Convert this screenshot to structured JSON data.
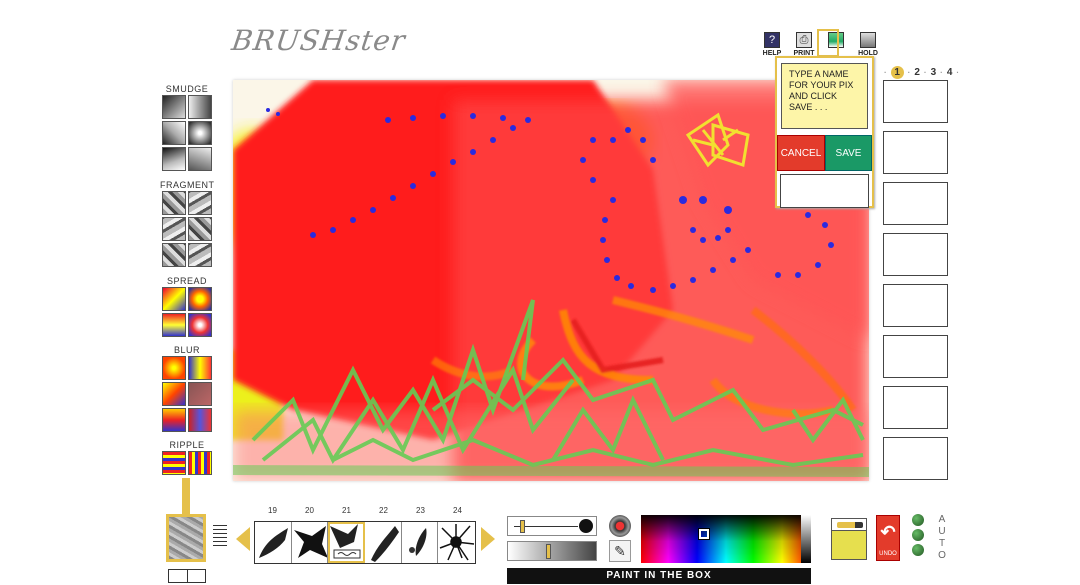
{
  "app": {
    "title": "BRUSHster"
  },
  "toolbar": {
    "help_label": "HELP",
    "print_label": "PRINT",
    "hold_label": "HOLD",
    "help_glyph": "?",
    "print_glyph": "⎙"
  },
  "tools": {
    "smudge_label": "SMUDGE",
    "fragment_label": "FRAGMENT",
    "spread_label": "SPREAD",
    "blur_label": "BLUR",
    "ripple_label": "RIPPLE"
  },
  "save_dialog": {
    "prompt": "TYPE A NAME FOR YOUR PIX AND CLICK SAVE . . .",
    "cancel_label": "CANCEL",
    "save_label": "SAVE",
    "name_value": ""
  },
  "gallery": {
    "pages": [
      "1",
      "2",
      "3",
      "4"
    ],
    "active_page": "1"
  },
  "brushes": {
    "numbers": [
      "19",
      "20",
      "21",
      "22",
      "23",
      "24"
    ],
    "selected": "21"
  },
  "status": {
    "text": "PAINT IN THE BOX"
  },
  "controls": {
    "undo_label": "UNDO",
    "undo_glyph": "↶",
    "auto_letters": [
      "A",
      "U",
      "T",
      "O"
    ],
    "dropper_glyph": "✎"
  },
  "colors": {
    "accent": "#e5c04a",
    "cancel": "#e33b2b",
    "save": "#1a9966",
    "current_color": "#e6df4e",
    "prompt_bg": "#fdf5a8"
  }
}
